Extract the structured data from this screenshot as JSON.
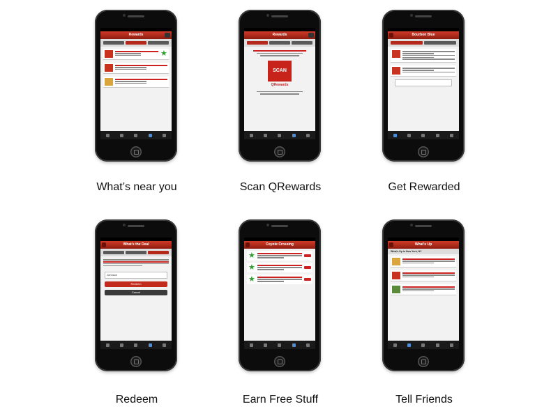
{
  "features": [
    {
      "label": "What’s near you",
      "screen": "rewards"
    },
    {
      "label": "Scan QRewards",
      "screen": "scan"
    },
    {
      "label": "Get Rewarded",
      "screen": "detail"
    },
    {
      "label": "Redeem",
      "screen": "redeem"
    },
    {
      "label": "Earn Free Stuff",
      "screen": "earn"
    },
    {
      "label": "Tell Friends",
      "screen": "social"
    }
  ],
  "screens": {
    "rewards": {
      "title": "Rewards"
    },
    "scan": {
      "title": "Rewards",
      "scan_text": "SCAN",
      "brand": "QRewards"
    },
    "detail": {
      "title": "Bourbon Blue"
    },
    "redeem": {
      "title": "What's the Deal",
      "name_value": "Johnson",
      "redeem_label": "Redeem",
      "cancel_label": "Cancel"
    },
    "earn": {
      "title": "Coyote Crossing"
    },
    "social": {
      "title": "What's Up",
      "subtitle": "What's Up in New York, NY"
    }
  },
  "colors": {
    "accent": "#c8231b",
    "star": "#2e9e2e",
    "phone": "#0c0c0c"
  }
}
